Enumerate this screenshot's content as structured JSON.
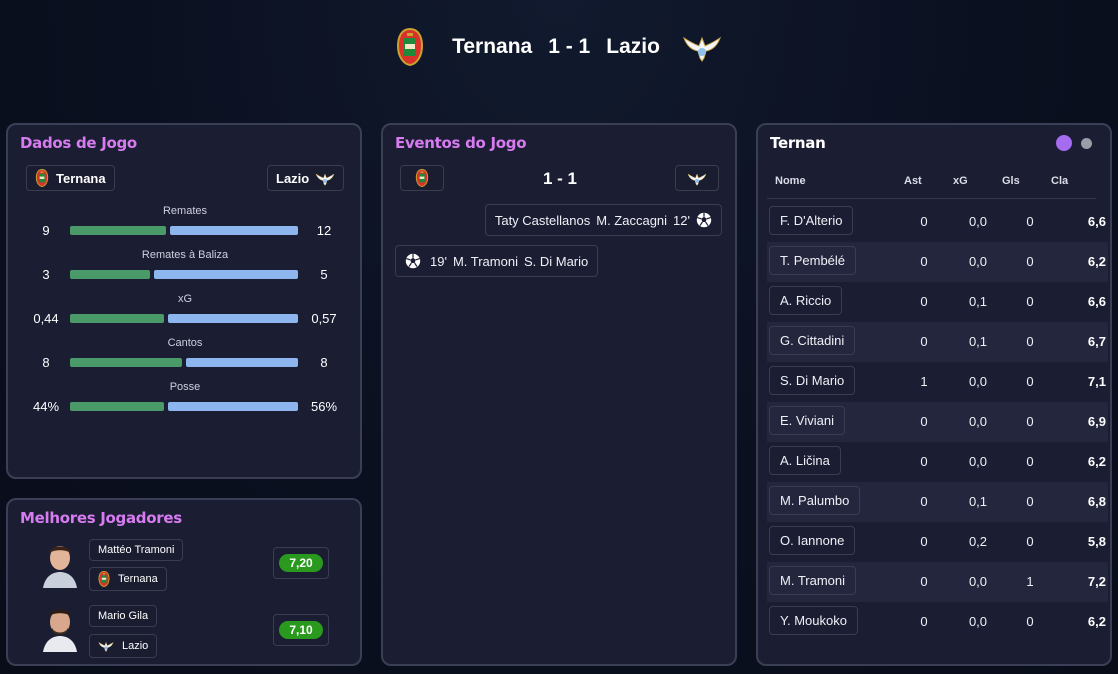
{
  "match": {
    "home_team": "Ternana",
    "away_team": "Lazio",
    "score": "1 - 1"
  },
  "stats_card": {
    "title": "Dados de Jogo",
    "home_label": "Ternana",
    "away_label": "Lazio",
    "stats": [
      {
        "label": "Remates",
        "home": "9",
        "away": "12",
        "home_share": 0.43
      },
      {
        "label": "Remates à Baliza",
        "home": "3",
        "away": "5",
        "home_share": 0.36
      },
      {
        "label": "xG",
        "home": "0,44",
        "away": "0,57",
        "home_share": 0.42
      },
      {
        "label": "Cantos",
        "home": "8",
        "away": "8",
        "home_share": 0.5
      },
      {
        "label": "Posse",
        "home": "44%",
        "away": "56%",
        "home_share": 0.42
      }
    ]
  },
  "best_players": {
    "title": "Melhores Jogadores",
    "players": [
      {
        "name": "Mattéo Tramoni",
        "team": "Ternana",
        "rating": "7,20"
      },
      {
        "name": "Mario Gila",
        "team": "Lazio",
        "rating": "7,10"
      }
    ]
  },
  "events_card": {
    "title": "Eventos do Jogo",
    "score": "1 - 1",
    "events": [
      {
        "side": "away",
        "scorer": "Taty Castellanos",
        "assist": "M. Zaccagni",
        "minute": "12'"
      },
      {
        "side": "home",
        "minute": "19'",
        "scorer": "M. Tramoni",
        "assist": "S. Di Mario"
      }
    ]
  },
  "player_table": {
    "title": "Ternan",
    "headers": {
      "name": "Nome",
      "ast": "Ast",
      "xg": "xG",
      "gls": "Gls",
      "cla": "Cla"
    },
    "rows": [
      {
        "name": "F. D'Alterio",
        "ast": "0",
        "xg": "0,0",
        "gls": "0",
        "cla": "6,6"
      },
      {
        "name": "T. Pembélé",
        "ast": "0",
        "xg": "0,0",
        "gls": "0",
        "cla": "6,2"
      },
      {
        "name": "A. Riccio",
        "ast": "0",
        "xg": "0,1",
        "gls": "0",
        "cla": "6,6"
      },
      {
        "name": "G. Cittadini",
        "ast": "0",
        "xg": "0,1",
        "gls": "0",
        "cla": "6,7"
      },
      {
        "name": "S. Di Mario",
        "ast": "1",
        "xg": "0,0",
        "gls": "0",
        "cla": "7,1"
      },
      {
        "name": "E. Viviani",
        "ast": "0",
        "xg": "0,0",
        "gls": "0",
        "cla": "6,9"
      },
      {
        "name": "A. Ličina",
        "ast": "0",
        "xg": "0,0",
        "gls": "0",
        "cla": "6,2"
      },
      {
        "name": "M. Palumbo",
        "ast": "0",
        "xg": "0,1",
        "gls": "0",
        "cla": "6,8"
      },
      {
        "name": "O. Iannone",
        "ast": "0",
        "xg": "0,2",
        "gls": "0",
        "cla": "5,8"
      },
      {
        "name": "M. Tramoni",
        "ast": "0",
        "xg": "0,0",
        "gls": "1",
        "cla": "7,2"
      },
      {
        "name": "Y. Moukoko",
        "ast": "0",
        "xg": "0,0",
        "gls": "0",
        "cla": "6,2"
      }
    ]
  },
  "colors": {
    "accent_title": "#d77cf0",
    "home_bar": "#4a9a69",
    "away_bar": "#8db6ef",
    "rating_green": "#2a9a1e",
    "toggle_active": "#a66cf0",
    "toggle_inactive": "#9a9ca8"
  },
  "icons": {
    "home_crest": "ternana-crest-icon",
    "away_crest": "lazio-eagle-icon",
    "goal": "soccer-ball-icon"
  }
}
